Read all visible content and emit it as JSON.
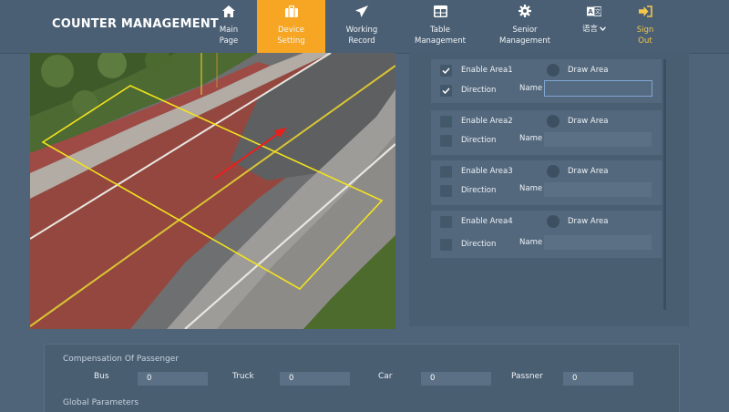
{
  "app": {
    "title": "COUNTER MANAGEMENT"
  },
  "nav": [
    {
      "label1": "Main",
      "label2": "Page",
      "icon": "home-icon",
      "active": false
    },
    {
      "label1": "Device",
      "label2": "Setting",
      "icon": "briefcase-icon",
      "active": true
    },
    {
      "label1": "Working",
      "label2": "Record",
      "icon": "send-icon",
      "active": false
    },
    {
      "label1": "Table",
      "label2": "Management",
      "icon": "table-icon",
      "active": false
    },
    {
      "label1": "Senior",
      "label2": "Management",
      "icon": "gear-icon",
      "active": false
    },
    {
      "label1": "语言",
      "label2": "",
      "icon": "language-icon",
      "active": false
    },
    {
      "label1": "Sign",
      "label2": "Out",
      "icon": "sign-out-icon",
      "active": false
    }
  ],
  "areas": [
    {
      "enable_label": "Enable Area1",
      "enable_checked": true,
      "draw_label": "Draw Area",
      "direction_label": "Direction",
      "direction_checked": true,
      "name_label": "Name",
      "name_value": ""
    },
    {
      "enable_label": "Enable Area2",
      "enable_checked": false,
      "draw_label": "Draw Area",
      "direction_label": "Direction",
      "direction_checked": false,
      "name_label": "Name",
      "name_value": ""
    },
    {
      "enable_label": "Enable Area3",
      "enable_checked": false,
      "draw_label": "Draw Area",
      "direction_label": "Direction",
      "direction_checked": false,
      "name_label": "Name",
      "name_value": ""
    },
    {
      "enable_label": "Enable Area4",
      "enable_checked": false,
      "draw_label": "Draw Area",
      "direction_label": "Direction",
      "direction_checked": false,
      "name_label": "Name",
      "name_value": ""
    }
  ],
  "compensation": {
    "title": "Compensation Of Passenger",
    "fields": [
      {
        "label": "Bus",
        "value": "0"
      },
      {
        "label": "Truck",
        "value": "0"
      },
      {
        "label": "Car",
        "value": "0"
      },
      {
        "label": "Passner",
        "value": "0"
      }
    ]
  },
  "global": {
    "title": "Global Parameters"
  },
  "colors": {
    "nav_active": "#f6a623",
    "sign_out": "#f4c64a",
    "zone_outline": "#f2e21e",
    "direction_arrow": "#e8201d"
  }
}
